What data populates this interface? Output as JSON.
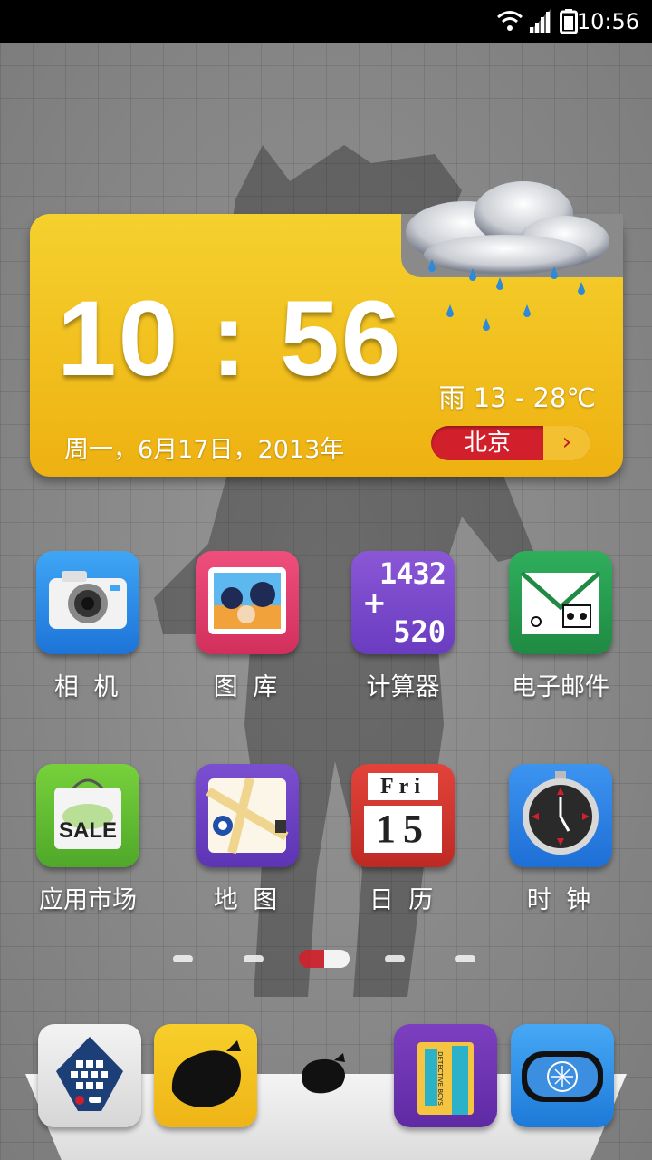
{
  "status_bar": {
    "time": "10:56",
    "icons": [
      "wifi-icon",
      "signal-icon",
      "battery-icon"
    ]
  },
  "clock_widget": {
    "time": "10 : 56",
    "weather": "雨 13 - 28℃",
    "date": "周一，6月17日，2013年",
    "city": "北京",
    "city_arrow": "›",
    "weather_icon": "rain-cloud-icon",
    "colors": {
      "panel": "#f2c21f",
      "city_button": "#d1202b"
    }
  },
  "apps_row1": [
    {
      "label": "相 机",
      "icon": "camera-icon"
    },
    {
      "label": "图 库",
      "icon": "gallery-icon"
    },
    {
      "label": "计算器",
      "icon": "calculator-icon",
      "digits_top": "1432",
      "digits_bottom": "520",
      "operator": "+"
    },
    {
      "label": "电子邮件",
      "icon": "mail-icon"
    }
  ],
  "apps_row2": [
    {
      "label": "应用市场",
      "icon": "shopping-bag-icon",
      "badge": "SALE"
    },
    {
      "label": "地 图",
      "icon": "map-icon"
    },
    {
      "label": "日 历",
      "icon": "calendar-icon",
      "day": "Fri",
      "date": "15"
    },
    {
      "label": "时 钟",
      "icon": "clock-icon"
    }
  ],
  "page_indicator": {
    "count": 5,
    "active_index": 2
  },
  "dock": [
    {
      "icon": "dialer-icon"
    },
    {
      "icon": "contacts-icon"
    },
    {
      "icon": "app-drawer-icon"
    },
    {
      "icon": "browser-icon",
      "text": "DETECTIVE BOYS"
    },
    {
      "icon": "settings-icon"
    }
  ]
}
